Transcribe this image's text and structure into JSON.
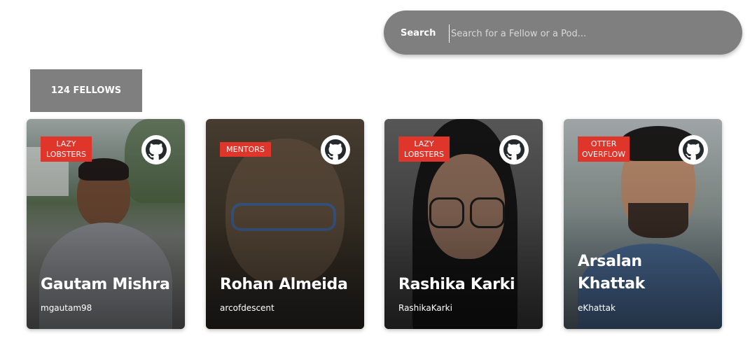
{
  "search": {
    "label": "Search",
    "placeholder": "Search for a Fellow or a Pod...",
    "value": ""
  },
  "fellows_count": "124 FELLOWS",
  "icons": {
    "github": "github-icon"
  },
  "colors": {
    "tag": "#e0352b",
    "search_bg": "#7f7f7f",
    "badge_bg": "#7f7f7f"
  },
  "cards": [
    {
      "pod": "LAZY\nLOBSTERS",
      "name": "Gautam Mishra",
      "handle": "mgautam98"
    },
    {
      "pod": "MENTORS",
      "name": "Rohan Almeida",
      "handle": "arcofdescent"
    },
    {
      "pod": "LAZY\nLOBSTERS",
      "name": "Rashika Karki",
      "handle": "RashikaKarki"
    },
    {
      "pod": "OTTER\nOVERFLOW",
      "name": "Arsalan Khattak",
      "handle": "eKhattak"
    }
  ]
}
